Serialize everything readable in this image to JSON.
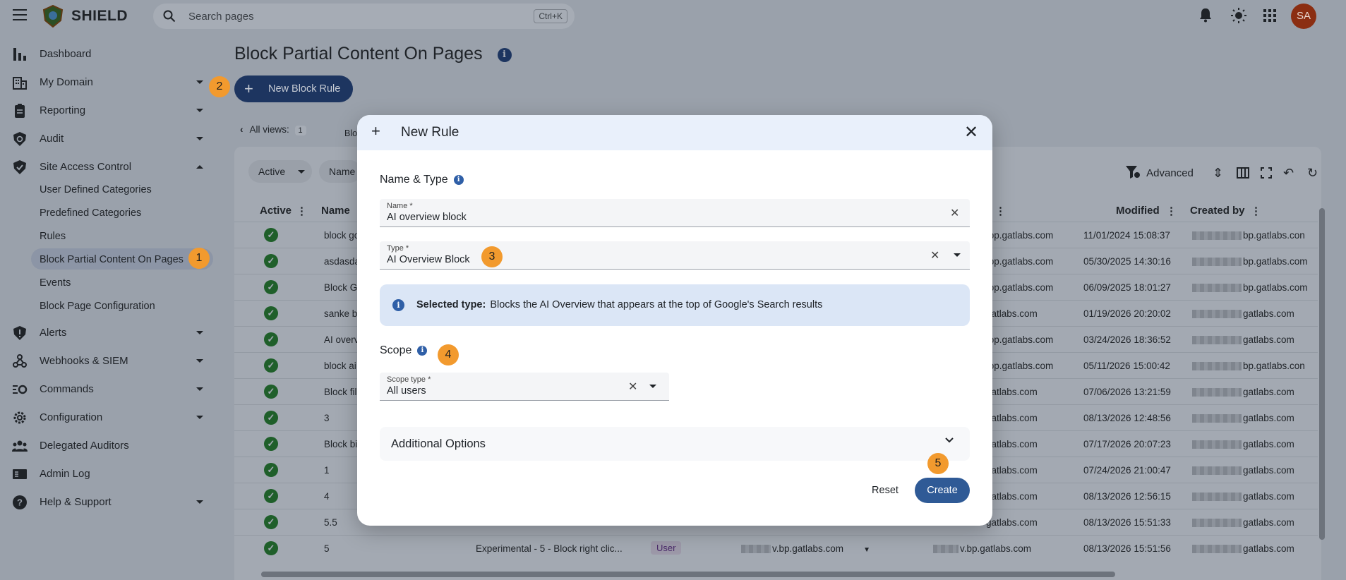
{
  "app": {
    "brand": "SHIELD"
  },
  "search": {
    "placeholder": "Search pages",
    "shortcut": "Ctrl+K"
  },
  "user": {
    "initials": "SA"
  },
  "sidebar": {
    "items": [
      {
        "label": "Dashboard",
        "icon": "bar-chart-icon"
      },
      {
        "label": "My Domain",
        "icon": "building-icon"
      },
      {
        "label": "Reporting",
        "icon": "clipboard-icon"
      },
      {
        "label": "Audit",
        "icon": "audit-shield-icon"
      },
      {
        "label": "Site Access Control",
        "icon": "shield-check-icon"
      },
      {
        "label": "Alerts",
        "icon": "alert-shield-icon"
      },
      {
        "label": "Webhooks & SIEM",
        "icon": "webhook-icon"
      },
      {
        "label": "Commands",
        "icon": "commands-icon"
      },
      {
        "label": "Configuration",
        "icon": "gear-icon"
      },
      {
        "label": "Delegated Auditors",
        "icon": "people-icon"
      },
      {
        "label": "Admin Log",
        "icon": "log-icon"
      },
      {
        "label": "Help & Support",
        "icon": "help-icon"
      }
    ],
    "subitems": [
      "User Defined Categories",
      "Predefined Categories",
      "Rules",
      "Block Partial Content On Pages",
      "Events",
      "Block Page Configuration"
    ]
  },
  "page": {
    "title": "Block Partial Content On Pages",
    "new_button": "New Block Rule",
    "views_label": "All views:",
    "views_count": "1",
    "tab_partial": "Blo"
  },
  "grid": {
    "filters": {
      "active": "Active",
      "name": "Name"
    },
    "advanced_label": "Advanced",
    "headers": {
      "active": "Active",
      "name": "Name",
      "modified": "Modified",
      "created_by": "Created by"
    },
    "rows": [
      {
        "name": "block go",
        "by_suffix": ".bp.gatlabs.com",
        "modified": "11/01/2024 15:08:37",
        "created_suffix": "bp.gatlabs.con"
      },
      {
        "name": "asdasda",
        "by_suffix": ".bp.gatlabs.com",
        "modified": "05/30/2025 14:30:16",
        "created_suffix": "bp.gatlabs.com"
      },
      {
        "name": "Block G",
        "by_suffix": ".bp.gatlabs.com",
        "modified": "06/09/2025 18:01:27",
        "created_suffix": "bp.gatlabs.com"
      },
      {
        "name": "sanke b",
        "by_suffix": "gatlabs.com",
        "modified": "01/19/2026 20:20:02",
        "created_suffix": "gatlabs.com"
      },
      {
        "name": "AI overv",
        "by_suffix": ".bp.gatlabs.com",
        "modified": "03/24/2026 18:36:52",
        "created_suffix": "gatlabs.com"
      },
      {
        "name": "block ai",
        "by_suffix": ".bp.gatlabs.com",
        "modified": "05/11/2026 15:00:42",
        "created_suffix": "bp.gatlabs.con"
      },
      {
        "name": "Block fil",
        "by_suffix": "gatlabs.com",
        "modified": "07/06/2026 13:21:59",
        "created_suffix": "gatlabs.com"
      },
      {
        "name": "3",
        "by_suffix": "gatlabs.com",
        "modified": "08/13/2026 12:48:56",
        "created_suffix": "gatlabs.com"
      },
      {
        "name": "Block bi",
        "by_suffix": "gatlabs.com",
        "modified": "07/17/2026 20:07:23",
        "created_suffix": "gatlabs.com"
      },
      {
        "name": "1",
        "by_suffix": "gatlabs.com",
        "modified": "07/24/2026 21:00:47",
        "created_suffix": "gatlabs.com"
      },
      {
        "name": "4",
        "by_suffix": "gatlabs.com",
        "modified": "08/13/2026 12:56:15",
        "created_suffix": "gatlabs.com"
      },
      {
        "name": "5.5",
        "by_suffix": "gatlabs.com",
        "modified": "08/13/2026 15:51:33",
        "created_suffix": "gatlabs.com"
      },
      {
        "name": "5",
        "desc": "Experimental - 5 - Block right clic...",
        "type": "User",
        "user_suffix": "v.bp.gatlabs.com",
        "by_suffix": "v.bp.gatlabs.com",
        "modified": "08/13/2026 15:51:56",
        "created_suffix": "gatlabs.com"
      }
    ]
  },
  "modal": {
    "title": "New Rule",
    "section_name_type": "Name & Type",
    "name_label": "Name *",
    "name_value": "AI overview block",
    "type_label": "Type *",
    "type_value": "AI Overview Block",
    "info_bold": "Selected type:",
    "info_text": "Blocks the AI Overview that appears at the top of Google's Search results",
    "section_scope": "Scope",
    "scope_label": "Scope type *",
    "scope_value": "All users",
    "additional_options": "Additional Options",
    "reset": "Reset",
    "create": "Create"
  },
  "badges": {
    "b1": "1",
    "b2": "2",
    "b3": "3",
    "b4": "4",
    "b5": "5"
  },
  "colors": {
    "primary": "#2f5a96",
    "badge": "#f29a2e",
    "success": "#1f5f2a",
    "avatar": "#8b2e12"
  }
}
